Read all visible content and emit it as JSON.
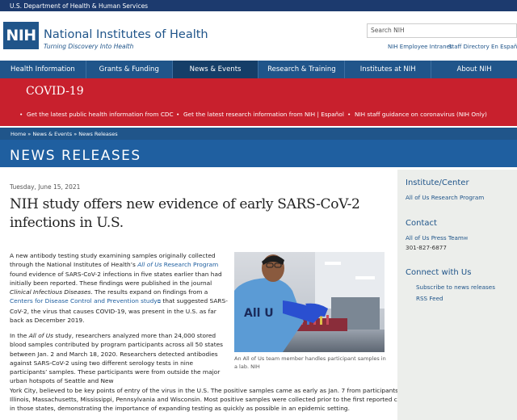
{
  "topbar": {
    "label": "U.S. Department of Health & Human Services"
  },
  "header": {
    "logo_text": "NIH",
    "title": "National Institutes of Health",
    "tagline": "Turning Discovery Into Health",
    "search_placeholder": "Search NIH",
    "utility_links": [
      "NIH Employee Intranet",
      "Staff Directory",
      "En Español"
    ]
  },
  "nav": {
    "items": [
      "Health Information",
      "Grants & Funding",
      "News & Events",
      "Research & Training",
      "Institutes at NIH",
      "About NIH"
    ],
    "active": "News & Events"
  },
  "covid": {
    "title": "COVID-19",
    "links": [
      "Get the latest public health information from CDC",
      "Get the latest research information from NIH | Español",
      "NIH staff guidance on coronavirus (NIH Only)"
    ]
  },
  "breadcrumb": {
    "items": [
      "Home",
      "News & Events",
      "News Releases"
    ],
    "separator": "»"
  },
  "section_title": "NEWS RELEASES",
  "article": {
    "date": "Tuesday, June 15, 2021",
    "headline": "NIH study offers new evidence of early SARS-CoV-2 infections in U.S.",
    "p1": {
      "t1": "A new antibody testing study examining samples originally collected through the National Institutes of Health’s ",
      "t2": "All of Us",
      "t3": " Research Program",
      "t4": " found evidence of SARS-CoV-2 infections in five states earlier than had initially been reported. These findings were published in the journal ",
      "t5": "Clinical Infectious Diseases",
      "t6": ". The results expand on findings from a ",
      "t7": "Centers for Disease Control and Prevention study",
      "t8": " that suggested SARS-CoV-2, the virus that causes COVID-19, was present in the U.S. as far back as December 2019."
    },
    "p2": {
      "t1": "In the ",
      "t2": "All of Us",
      "t3": " study, researchers analyzed more than 24,000 stored blood samples contributed by program participants across all 50 states between Jan. 2 and March 18, 2020. Researchers detected antibodies against SARS-CoV-2 using two different serology tests in nine participants’ samples. These participants were from outside the major urban hotspots of Seattle and New",
      "line1": "York City, believed to be key points of entry of the virus in the U.S. The positive samples came as early as Jan. 7 from participants in",
      "line2": "Illinois, Massachusetts, Mississippi, Pennsylvania and Wisconsin. Most positive samples were collected prior to the first reported cases",
      "line3": "in those states, demonstrating the importance of expanding testing as quickly as possible in an epidemic setting."
    },
    "photo_caption": "An All of Us team member handles participant samples in a lab. NIH",
    "shirt_text": "All U"
  },
  "sidebar": {
    "institute_heading": "Institute/Center",
    "institute_link": "All of Us Research Program",
    "contact_heading": "Contact",
    "contact_link": "All of Us Press Team",
    "contact_phone": "301-827-6877",
    "connect_heading": "Connect with Us",
    "connect_links": [
      "Subscribe to news releases",
      "RSS Feed"
    ]
  }
}
